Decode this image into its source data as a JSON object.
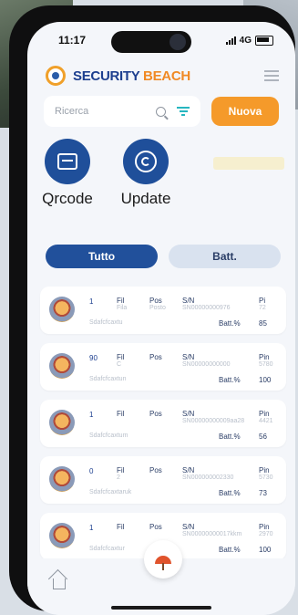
{
  "status": {
    "time": "11:17",
    "network": "4G"
  },
  "brand": {
    "part1": "SECURITY",
    "part2": "BEACH"
  },
  "search": {
    "placeholder": "Ricerca"
  },
  "new_button": "Nuova",
  "actions": [
    {
      "label": "Qrcode",
      "icon": "qrcode-scan-icon"
    },
    {
      "label": "Update",
      "icon": "update-icon"
    }
  ],
  "tabs": [
    "Tutto",
    "Batt."
  ],
  "list": [
    {
      "num": "1",
      "fil": "Fil",
      "fil_val": "Fila",
      "pos": "Pos",
      "pos_val": "Posto",
      "sn": "S/N",
      "sn_val": "SN00000000976",
      "pin": "Pi",
      "pin_val": "72",
      "sub": "Sdafcfcaxtu",
      "batt_label": "Batt.%",
      "batt_val": "85"
    },
    {
      "num": "90",
      "fil": "Fil",
      "fil_val": "C",
      "pos": "Pos",
      "pos_val": "",
      "sn": "S/N",
      "sn_val": "SN00000000000",
      "pin": "Pin",
      "pin_val": "5780",
      "sub": "Sdafcfcaxtun",
      "batt_label": "Batt.%",
      "batt_val": "100"
    },
    {
      "num": "1",
      "fil": "Fil",
      "fil_val": "",
      "pos": "Pos",
      "pos_val": "",
      "sn": "S/N",
      "sn_val": "SN00000000009aa28",
      "pin": "Pin",
      "pin_val": "4421",
      "sub": "Sdafcfcaxtum",
      "batt_label": "Batt.%",
      "batt_val": "56"
    },
    {
      "num": "0",
      "fil": "Fil",
      "fil_val": "2",
      "pos": "Pos",
      "pos_val": "",
      "sn": "S/N",
      "sn_val": "SN000000002330",
      "pin": "Pin",
      "pin_val": "5730",
      "sub": "Sdafcfcaxtaruk",
      "batt_label": "Batt.%",
      "batt_val": "73"
    },
    {
      "num": "1",
      "fil": "Fil",
      "fil_val": "",
      "pos": "Pos",
      "pos_val": "",
      "sn": "S/N",
      "sn_val": "SN00000000017kkm",
      "pin": "Pin",
      "pin_val": "2970",
      "sub": "Sdafcfcaxtur",
      "batt_label": "Batt.%",
      "batt_val": "100"
    }
  ],
  "colors": {
    "primary": "#21509b",
    "accent": "#f59a2a",
    "tab_inactive": "#d9e2ef"
  }
}
